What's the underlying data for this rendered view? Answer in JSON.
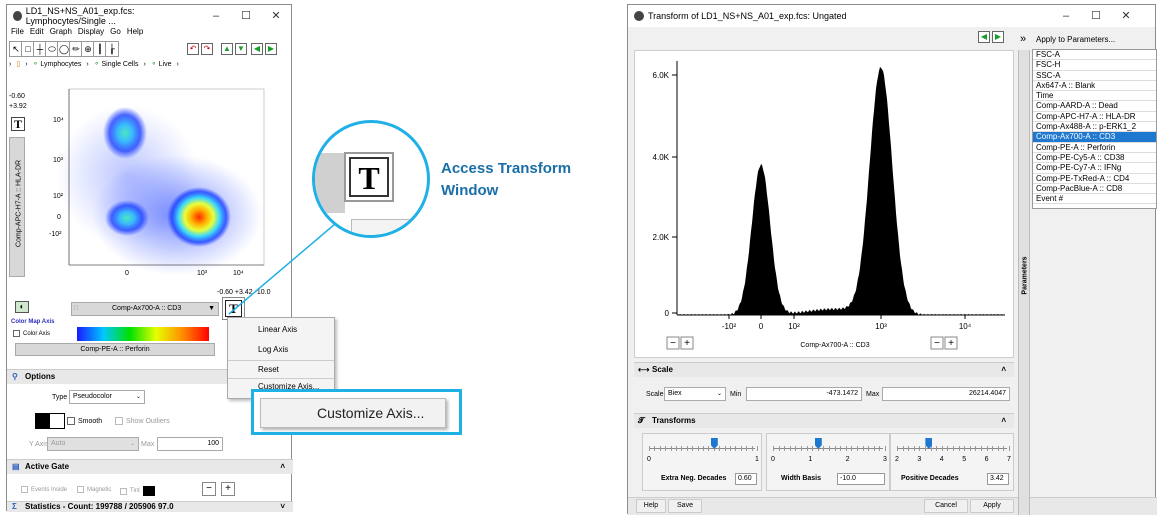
{
  "left_window": {
    "title": "LD1_NS+NS_A01_exp.fcs: Lymphocytes/Single ...",
    "menu": [
      "File",
      "Edit",
      "Graph",
      "Display",
      "Go",
      "Help"
    ],
    "breadcrumb": [
      "Lymphocytes",
      "Single Cells",
      "Live"
    ],
    "color_range": {
      "min": "-0.60",
      "max": "+3.92"
    },
    "y_axis_label": "Comp-APC-H7-A :: HLA-DR",
    "y_ticks": [
      "10⁴",
      "10³",
      "10²",
      "0",
      "-10²"
    ],
    "x_ticks": [
      "0",
      "10³",
      "10⁴"
    ],
    "x_ticks_minor": [
      "-10²"
    ],
    "x_range_readout": "-0.60 +3.42 -10.0",
    "x_param": "Comp-Ax700-A :: CD3",
    "color_map_title": "Color Map Axis",
    "color_axis_label": "Color Axis",
    "color_param": "Comp-PE-A :: Perforin",
    "options": {
      "title": "Options",
      "type_label": "Type",
      "type_value": "Pseudocolor",
      "smooth": "Smooth",
      "outliers": "Show Outliers",
      "yaxis_label": "Y Axis",
      "yaxis_value": "Auto",
      "max_label": "Max",
      "max_value": "100"
    },
    "active_gate": {
      "title": "Active Gate",
      "events_inside": "Events Inside",
      "magnetic": "Magnetic",
      "tint": "Tint"
    },
    "statistics": "Statistics - Count: 199788 / 205906 97.0",
    "context_menu": [
      "Linear Axis",
      "Log Axis",
      "Reset",
      "Customize Axis..."
    ],
    "callout_button": "Customize Axis...",
    "t_icon": "T"
  },
  "callout": {
    "text": "Access Transform Window",
    "color": "#1a6fa8"
  },
  "right_window": {
    "title": "Transform of LD1_NS+NS_A01_exp.fcs: Ungated",
    "apply_to": "Apply to Parameters...",
    "chevron": "»",
    "parameters": [
      "FSC-A",
      "FSC-H",
      "SSC-A",
      "Ax647-A :: Blank",
      "Time",
      "Comp-AARD-A :: Dead",
      "Comp-APC-H7-A :: HLA-DR",
      "Comp-Ax488-A :: p-ERK1_2",
      "Comp-Ax700-A :: CD3",
      "Comp-PE-A :: Perforin",
      "Comp-PE-Cy5-A :: CD38",
      "Comp-PE-Cy7-A :: IFNg",
      "Comp-PE-TxRed-A :: CD4",
      "Comp-PacBlue-A :: CD8",
      "Event #"
    ],
    "selected_index": 8,
    "params_tab": "Parameters",
    "y_ticks": [
      "6.0K",
      "4.0K",
      "2.0K",
      "0"
    ],
    "x_ticks": [
      "-10²",
      "0",
      "10²",
      "10³",
      "10⁴"
    ],
    "x_label": "Comp-Ax700-A :: CD3",
    "scale": {
      "title": "Scale",
      "label": "Scale",
      "value": "Biex",
      "min_label": "Min",
      "min_value": "-473.1472",
      "max_label": "Max",
      "max_value": "26214.4047"
    },
    "transforms": {
      "title": "Transforms",
      "s1": {
        "ticks": [
          "0",
          "1"
        ],
        "label": "Extra Neg. Decades",
        "value": "0.60"
      },
      "s2": {
        "ticks": [
          "0",
          "1",
          "2",
          "3"
        ],
        "label": "Width Basis",
        "value": "-10.0"
      },
      "s3": {
        "ticks": [
          "2",
          "3",
          "4",
          "5",
          "6",
          "7"
        ],
        "label": "Positive Decades",
        "value": "3.42"
      }
    },
    "buttons": {
      "help": "Help",
      "save": "Save",
      "cancel": "Cancel",
      "apply": "Apply"
    }
  }
}
